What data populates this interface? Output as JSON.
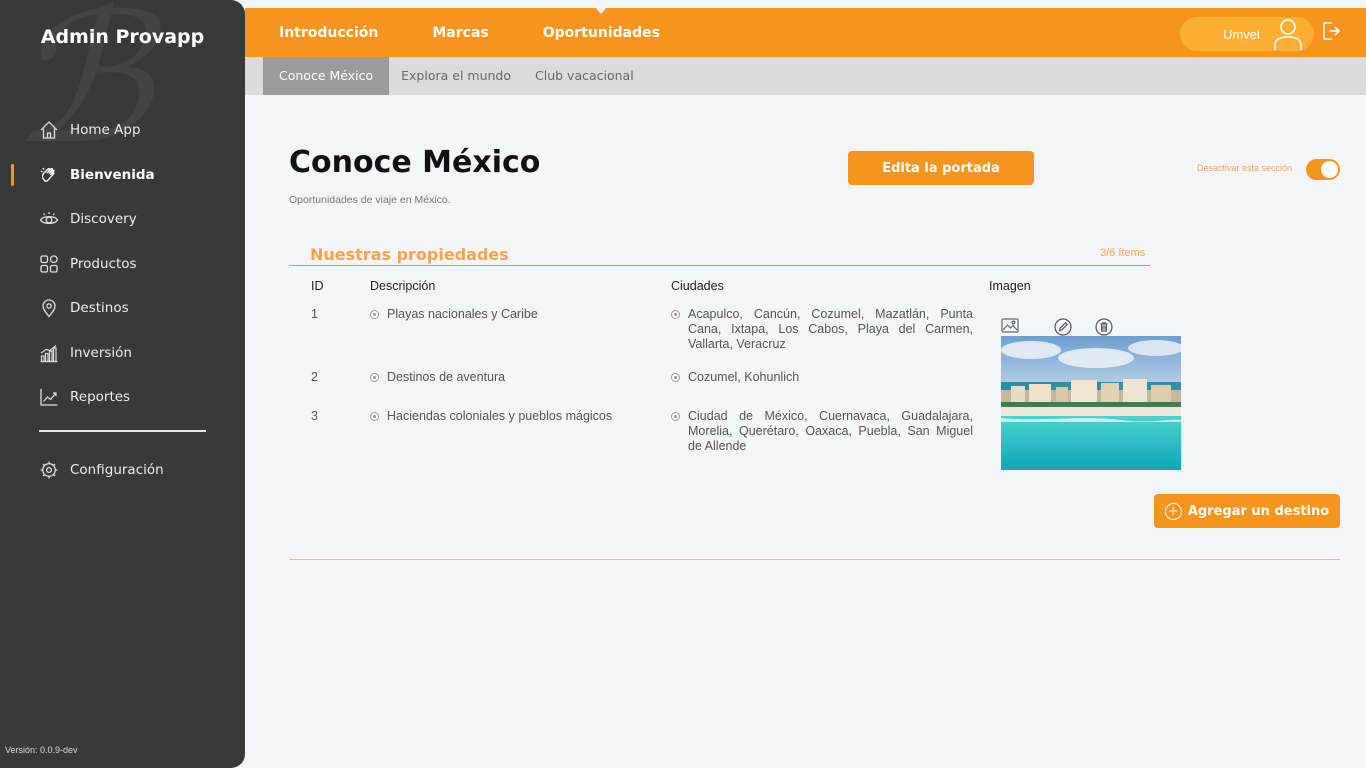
{
  "sidebar": {
    "brand": "Admin Provapp",
    "items": [
      {
        "label": "Home App",
        "icon": "home-icon"
      },
      {
        "label": "Bienvenida",
        "icon": "hand-wave-icon"
      },
      {
        "label": "Discovery",
        "icon": "eye-icon"
      },
      {
        "label": "Productos",
        "icon": "grid-icon"
      },
      {
        "label": "Destinos",
        "icon": "map-pin-icon"
      },
      {
        "label": "Inversión",
        "icon": "bar-chart-icon"
      },
      {
        "label": "Reportes",
        "icon": "line-chart-icon"
      }
    ],
    "config_label": "Configuración",
    "version": "Versión: 0.0.9-dev"
  },
  "topbar": {
    "tabs": [
      "Introducción",
      "Marcas",
      "Oportunidades"
    ],
    "active_tab": "Oportunidades",
    "user_name": "Umvel"
  },
  "subtabs": [
    "Conoce México",
    "Explora el mundo",
    "Club vacacional"
  ],
  "main": {
    "title": "Conoce México",
    "subtitle": "Oportunidades de viaje en México.",
    "edit_cover_label": "Edita la portada",
    "toggle_label": "Desactivar esta sección",
    "section_title": "Nuestras propiedades",
    "section_count": "3/6 ítems",
    "columns": [
      "ID",
      "Descripción",
      "Ciudades",
      "Imagen"
    ],
    "rows": [
      {
        "id": "1",
        "description": "Playas nacionales y Caribe",
        "cities": "Acapulco, Cancún, Cozumel, Mazatlán, Punta Cana, Ixtapa, Los Cabos, Playa del Carmen, Vallarta, Veracruz"
      },
      {
        "id": "2",
        "description": "Destinos de aventura",
        "cities": "Cozumel, Kohunlich"
      },
      {
        "id": "3",
        "description": "Haciendas coloniales y pueblos mágicos",
        "cities": "Ciudad de México, Cuernavaca, Guadalajara, Morelia, Querétaro, Oaxaca, Puebla, San Miguel de Allende"
      }
    ],
    "add_destination_label": "Agregar un destino"
  },
  "colors": {
    "accent": "#f7941d",
    "sidebar_bg": "#393939",
    "page_bg": "#f4f5f8"
  }
}
